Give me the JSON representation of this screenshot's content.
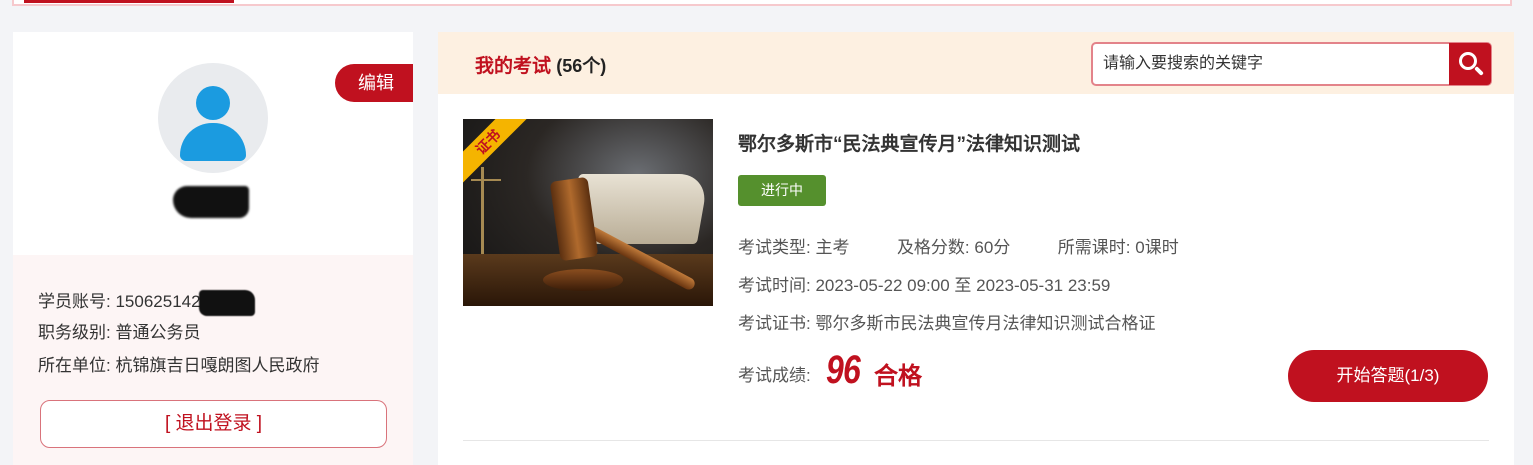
{
  "colors": {
    "accent": "#c0111f",
    "status_green": "#55902d",
    "header_bg": "#fdf0e1",
    "panel_bg": "#fdf5f5"
  },
  "profile": {
    "name": "",
    "edit_label": "编辑",
    "account_label": "学员账号:",
    "account_value": "150625142",
    "rank_label": "职务级别:",
    "rank_value": "普通公务员",
    "unit_label": "所在单位:",
    "unit_value": "杭锦旗吉日嘎朗图人民政府",
    "logout_label": "[ 退出登录 ]"
  },
  "exams": {
    "title": "我的考试",
    "count": "(56个)",
    "search_placeholder": "请输入要搜索的关键字",
    "items": [
      {
        "badge": "证书",
        "name": "鄂尔多斯市“民法典宣传月”法律知识测试",
        "status": "进行中",
        "type_label": "考试类型:",
        "type_value": "主考",
        "pass_label": "及格分数:",
        "pass_value": "60分",
        "hours_label": "所需课时:",
        "hours_value": "0课时",
        "time_label": "考试时间:",
        "time_value": "2023-05-22 09:00 至 2023-05-31 23:59",
        "cert_label": "考试证书:",
        "cert_value": "鄂尔多斯市民法典宣传月法律知识测试合格证",
        "score_label": "考试成绩:",
        "score_value": "96",
        "score_result": "合格",
        "action_label": "开始答题(1/3)"
      }
    ]
  }
}
